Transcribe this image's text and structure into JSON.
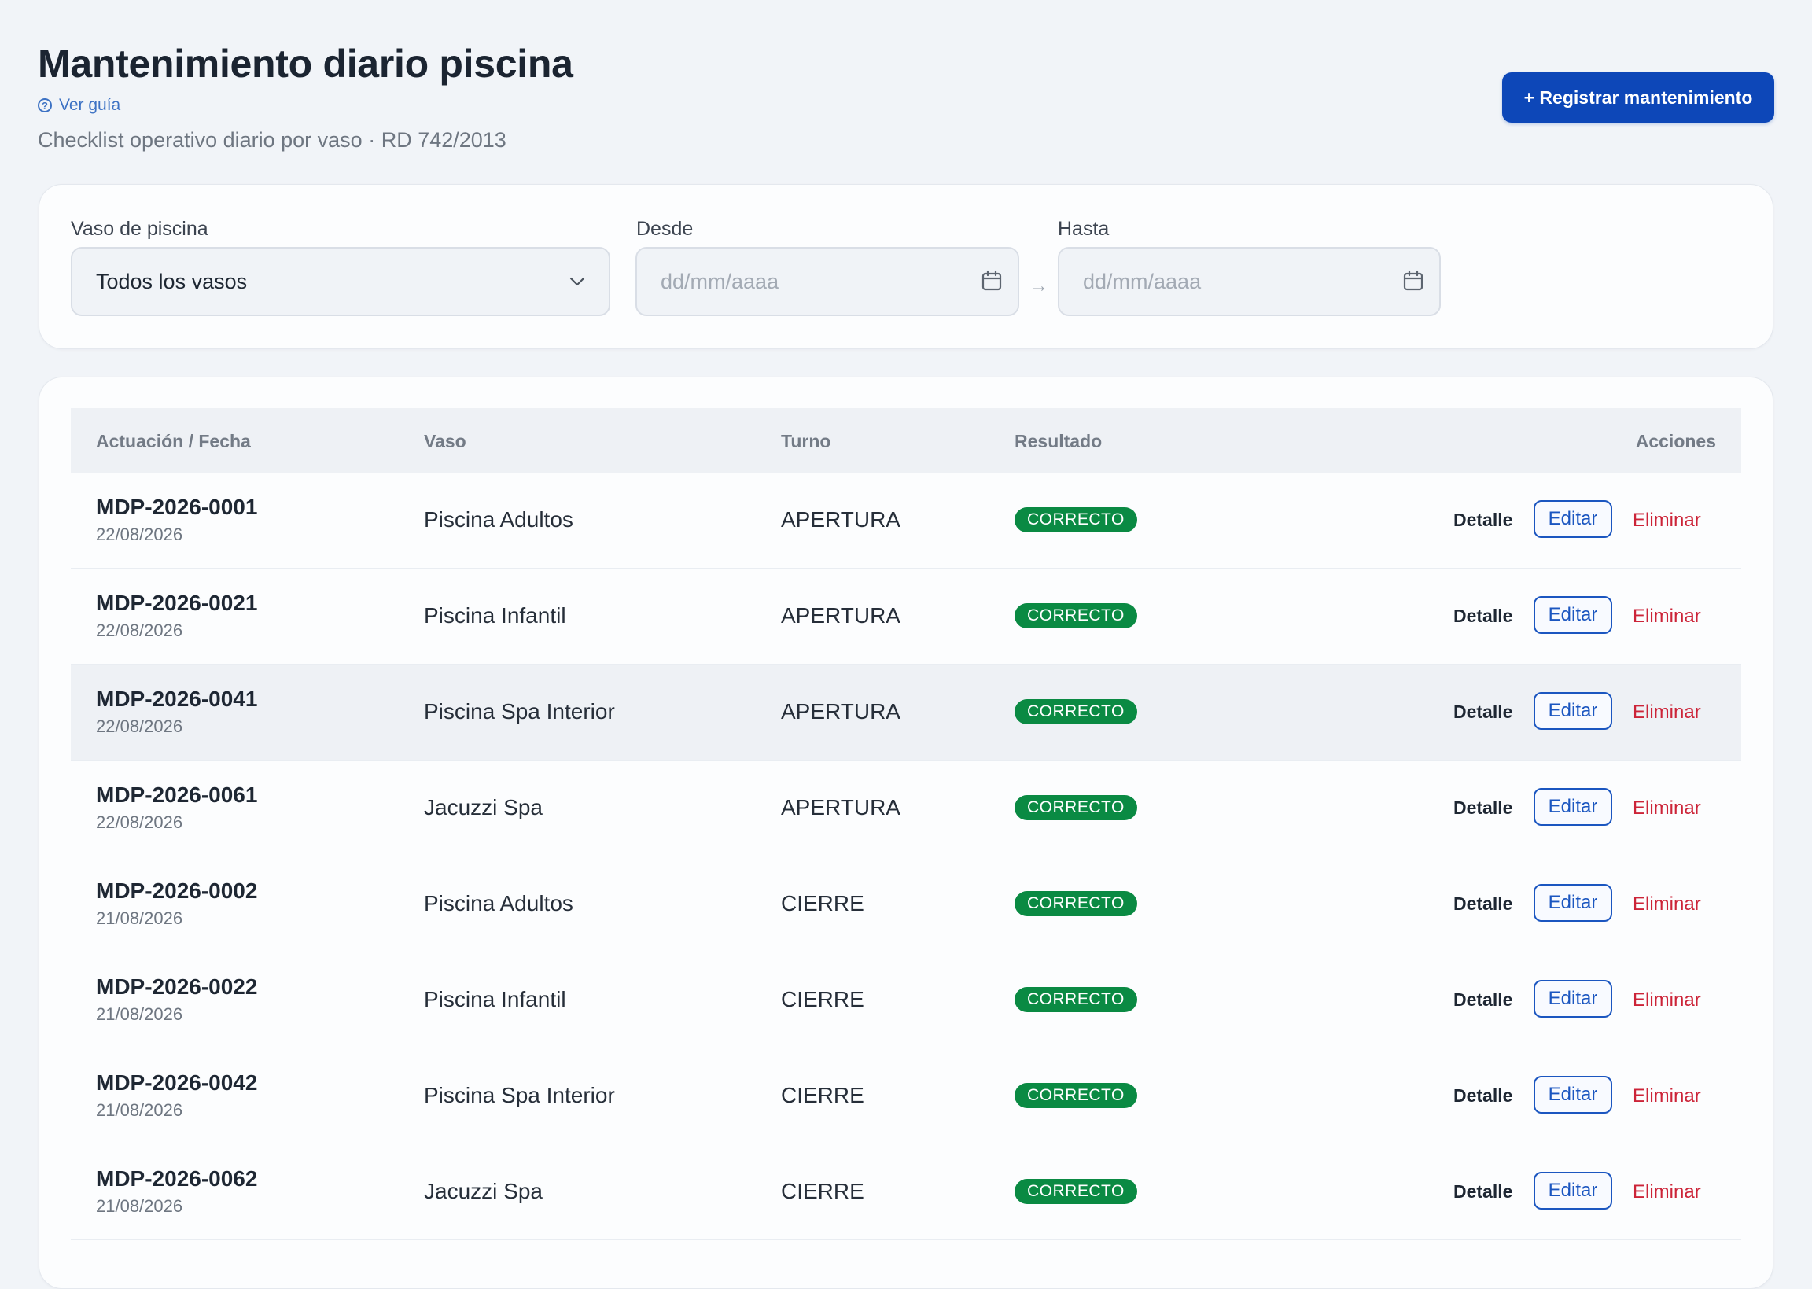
{
  "header": {
    "title": "Mantenimiento diario piscina",
    "guide_link": "Ver guía",
    "subtitle": "Checklist operativo diario por vaso · RD 742/2013",
    "register_button": "+ Registrar mantenimiento"
  },
  "filters": {
    "vaso": {
      "label": "Vaso de piscina",
      "value": "Todos los vasos"
    },
    "desde": {
      "label": "Desde",
      "placeholder": "dd/mm/aaaa"
    },
    "hasta": {
      "label": "Hasta",
      "placeholder": "dd/mm/aaaa"
    },
    "range_separator": "→"
  },
  "table": {
    "columns": {
      "actuacion": "Actuación / Fecha",
      "vaso": "Vaso",
      "turno": "Turno",
      "resultado": "Resultado",
      "acciones": "Acciones"
    },
    "actions": {
      "detalle": "Detalle",
      "editar": "Editar",
      "eliminar": "Eliminar"
    },
    "rows": [
      {
        "code": "MDP-2026-0001",
        "date": "22/08/2026",
        "vaso": "Piscina Adultos",
        "turno": "APERTURA",
        "resultado": "CORRECTO"
      },
      {
        "code": "MDP-2026-0021",
        "date": "22/08/2026",
        "vaso": "Piscina Infantil",
        "turno": "APERTURA",
        "resultado": "CORRECTO"
      },
      {
        "code": "MDP-2026-0041",
        "date": "22/08/2026",
        "vaso": "Piscina Spa Interior",
        "turno": "APERTURA",
        "resultado": "CORRECTO"
      },
      {
        "code": "MDP-2026-0061",
        "date": "22/08/2026",
        "vaso": "Jacuzzi Spa",
        "turno": "APERTURA",
        "resultado": "CORRECTO"
      },
      {
        "code": "MDP-2026-0002",
        "date": "21/08/2026",
        "vaso": "Piscina Adultos",
        "turno": "CIERRE",
        "resultado": "CORRECTO"
      },
      {
        "code": "MDP-2026-0022",
        "date": "21/08/2026",
        "vaso": "Piscina Infantil",
        "turno": "CIERRE",
        "resultado": "CORRECTO"
      },
      {
        "code": "MDP-2026-0042",
        "date": "21/08/2026",
        "vaso": "Piscina Spa Interior",
        "turno": "CIERRE",
        "resultado": "CORRECTO"
      },
      {
        "code": "MDP-2026-0062",
        "date": "21/08/2026",
        "vaso": "Jacuzzi Spa",
        "turno": "CIERRE",
        "resultado": "CORRECTO"
      }
    ]
  },
  "icons": {
    "guide": "question-circle-icon",
    "select": "chevron-down-icon",
    "date": "calendar-icon"
  },
  "colors": {
    "primary": "#0d47b8",
    "success": "#0a8a43",
    "danger": "#cc2438",
    "background": "#f1f4f8"
  }
}
